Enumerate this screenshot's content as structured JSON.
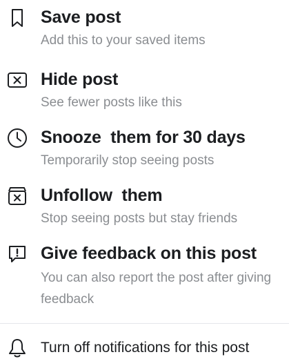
{
  "menu": {
    "save": {
      "title": "Save post",
      "subtitle": "Add this to your saved items",
      "icon": "bookmark-icon"
    },
    "hide": {
      "title": "Hide post",
      "subtitle": "See fewer posts like this",
      "icon": "close-box-icon"
    },
    "snooze": {
      "title_prefix": "Snooze",
      "title_suffix": "them for 30 days",
      "subtitle": "Temporarily stop seeing posts",
      "icon": "clock-icon"
    },
    "unfollow": {
      "title_prefix": "Unfollow",
      "title_suffix": "them",
      "subtitle": "Stop seeing posts but stay friends",
      "icon": "unfollow-box-icon"
    },
    "feedback": {
      "title": "Give feedback on this post",
      "subtitle": "You can also report the post after giving feedback",
      "icon": "feedback-icon"
    },
    "notifications": {
      "title": "Turn off notifications for this post",
      "icon": "bell-icon"
    }
  }
}
